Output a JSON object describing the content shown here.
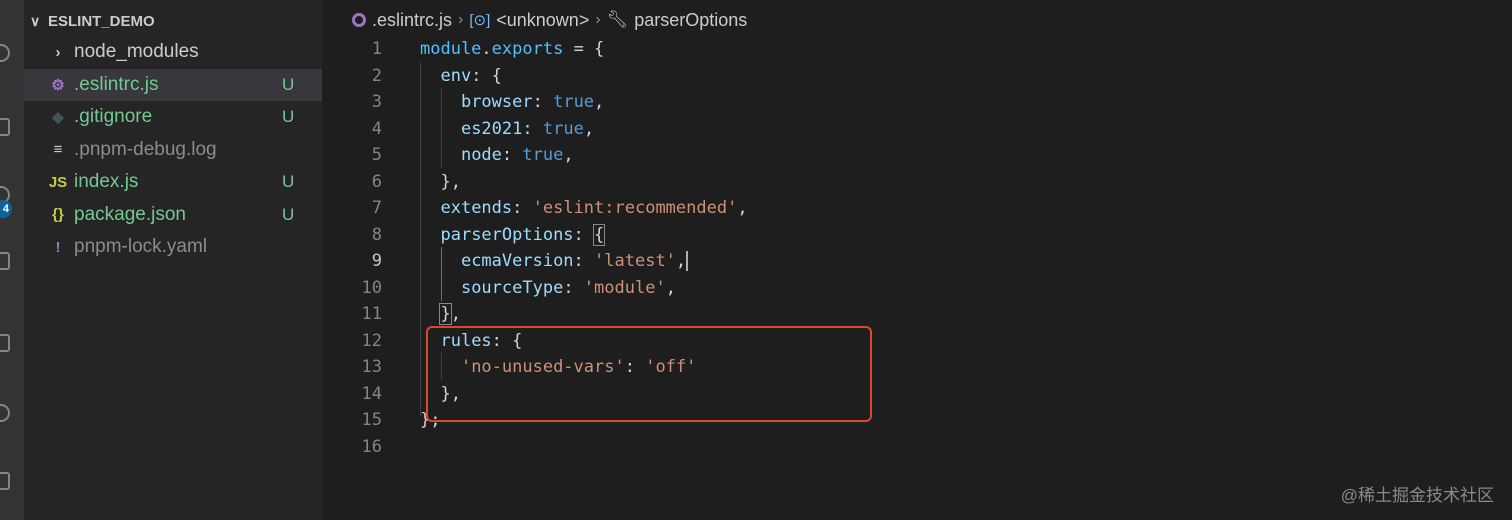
{
  "explorer": {
    "folder_name": "ESLINT_DEMO",
    "items": [
      {
        "icon": "›",
        "name": "node_modules",
        "status": "",
        "kind": "folder"
      },
      {
        "icon": "⚙",
        "name": ".eslintrc.js",
        "status": "U",
        "kind": "active"
      },
      {
        "icon": "◆",
        "name": ".gitignore",
        "status": "U",
        "kind": "git-u"
      },
      {
        "icon": "≡",
        "name": ".pnpm-debug.log",
        "status": "",
        "kind": "ignored"
      },
      {
        "icon": "JS",
        "name": "index.js",
        "status": "U",
        "kind": "git-u"
      },
      {
        "icon": "{}",
        "name": "package.json",
        "status": "U",
        "kind": "git-u"
      },
      {
        "icon": "!",
        "name": "pnpm-lock.yaml",
        "status": "",
        "kind": "ignored"
      }
    ]
  },
  "activity_bar": {
    "badge_count": "4"
  },
  "breadcrumb": {
    "file": ".eslintrc.js",
    "symbol": "<unknown>",
    "property": "parserOptions"
  },
  "editor": {
    "current_line": 9,
    "lines": [
      {
        "n": "1",
        "tokens": [
          [
            "tk-var",
            "module"
          ],
          [
            "tk-p",
            "."
          ],
          [
            "tk-var",
            "exports"
          ],
          [
            "tk-p",
            " = {"
          ]
        ]
      },
      {
        "n": "2",
        "tokens": [
          [
            "tk-p",
            "  "
          ],
          [
            "tk-id",
            "env"
          ],
          [
            "tk-p",
            ": {"
          ]
        ]
      },
      {
        "n": "3",
        "tokens": [
          [
            "tk-p",
            "    "
          ],
          [
            "tk-id",
            "browser"
          ],
          [
            "tk-p",
            ": "
          ],
          [
            "tk-kw",
            "true"
          ],
          [
            "tk-p",
            ","
          ]
        ]
      },
      {
        "n": "4",
        "tokens": [
          [
            "tk-p",
            "    "
          ],
          [
            "tk-id",
            "es2021"
          ],
          [
            "tk-p",
            ": "
          ],
          [
            "tk-kw",
            "true"
          ],
          [
            "tk-p",
            ","
          ]
        ]
      },
      {
        "n": "5",
        "tokens": [
          [
            "tk-p",
            "    "
          ],
          [
            "tk-id",
            "node"
          ],
          [
            "tk-p",
            ": "
          ],
          [
            "tk-kw",
            "true"
          ],
          [
            "tk-p",
            ","
          ]
        ]
      },
      {
        "n": "6",
        "tokens": [
          [
            "tk-p",
            "  },"
          ]
        ]
      },
      {
        "n": "7",
        "tokens": [
          [
            "tk-p",
            "  "
          ],
          [
            "tk-id",
            "extends"
          ],
          [
            "tk-p",
            ": "
          ],
          [
            "tk-str",
            "'eslint:recommended'"
          ],
          [
            "tk-p",
            ","
          ]
        ]
      },
      {
        "n": "8",
        "tokens": [
          [
            "tk-p",
            "  "
          ],
          [
            "tk-id",
            "parserOptions"
          ],
          [
            "tk-p",
            ": "
          ],
          [
            "tk-p brk",
            "{"
          ]
        ]
      },
      {
        "n": "9",
        "tokens": [
          [
            "tk-p",
            "    "
          ],
          [
            "tk-id",
            "ecmaVersion"
          ],
          [
            "tk-p",
            ": "
          ],
          [
            "tk-str",
            "'latest'"
          ],
          [
            "tk-p",
            ","
          ]
        ]
      },
      {
        "n": "10",
        "tokens": [
          [
            "tk-p",
            "    "
          ],
          [
            "tk-id",
            "sourceType"
          ],
          [
            "tk-p",
            ": "
          ],
          [
            "tk-str",
            "'module'"
          ],
          [
            "tk-p",
            ","
          ]
        ]
      },
      {
        "n": "11",
        "tokens": [
          [
            "tk-p",
            "  "
          ],
          [
            "tk-p brk",
            "}"
          ],
          [
            "tk-p",
            ","
          ]
        ]
      },
      {
        "n": "12",
        "tokens": [
          [
            "tk-p",
            "  "
          ],
          [
            "tk-id",
            "rules"
          ],
          [
            "tk-p",
            ": {"
          ]
        ]
      },
      {
        "n": "13",
        "tokens": [
          [
            "tk-p",
            "    "
          ],
          [
            "tk-str",
            "'no-unused-vars'"
          ],
          [
            "tk-p",
            ": "
          ],
          [
            "tk-str",
            "'off'"
          ]
        ]
      },
      {
        "n": "14",
        "tokens": [
          [
            "tk-p",
            "  },"
          ]
        ]
      },
      {
        "n": "15",
        "tokens": [
          [
            "tk-p",
            "};"
          ]
        ]
      },
      {
        "n": "16",
        "tokens": []
      }
    ]
  },
  "watermark": "@稀土掘金技术社区"
}
